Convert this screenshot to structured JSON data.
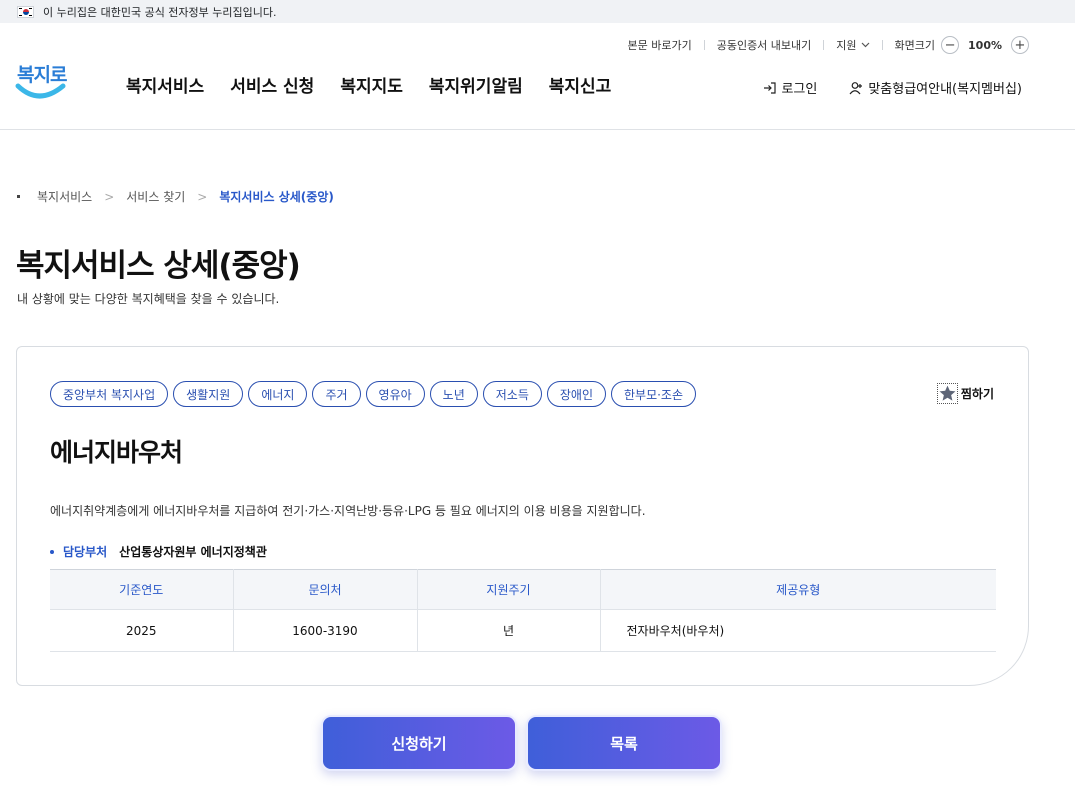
{
  "gov_banner": {
    "text": "이 누리집은 대한민국 공식 전자정부 누리집입니다."
  },
  "util": {
    "skip": "본문 바로가기",
    "cert": "공동인증서 내보내기",
    "support": "지원",
    "zoom_label": "화면크기",
    "zoom_minus": "−",
    "zoom_value": "100%",
    "zoom_plus": "+"
  },
  "logo": {
    "text": "복지로"
  },
  "gnb": [
    "복지서비스",
    "서비스 신청",
    "복지지도",
    "복지위기알림",
    "복지신고"
  ],
  "user_links": {
    "login": "로그인",
    "membership": "맞춤형급여안내(복지멤버십)"
  },
  "breadcrumb": [
    "복지서비스",
    "서비스 찾기",
    "복지서비스 상세(중앙)"
  ],
  "page": {
    "title": "복지서비스 상세(중앙)",
    "desc": "내 상황에 맞는 다양한 복지혜택을 찾을 수 있습니다."
  },
  "service": {
    "tags": [
      "중앙부처 복지사업",
      "생활지원",
      "에너지",
      "주거",
      "영유아",
      "노년",
      "저소득",
      "장애인",
      "한부모·조손"
    ],
    "favorite_label": "찜하기",
    "title": "에너지바우처",
    "desc": "에너지취약계층에게 에너지바우처를 지급하여 전기·가스·지역난방·등유·LPG 등 필요 에너지의 이용 비용을 지원합니다.",
    "dept_label": "담당부처",
    "dept_value": "산업통상자원부 에너지정책관",
    "table": {
      "headers": [
        "기준연도",
        "문의처",
        "지원주기",
        "제공유형"
      ],
      "row": [
        "2025",
        "1600-3190",
        "년",
        "전자바우처(바우처)"
      ]
    }
  },
  "buttons": {
    "apply": "신청하기",
    "list": "목록"
  },
  "colors": {
    "accent": "#2958c9",
    "button_start": "#3f5fd9",
    "button_end": "#6c5ae6"
  }
}
